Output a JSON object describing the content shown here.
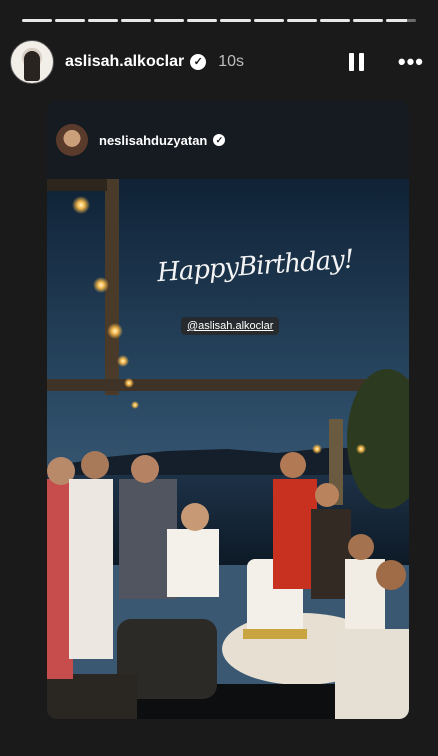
{
  "story": {
    "username": "aslisah.alkoclar",
    "time": "10s",
    "verified_glyph": "✓",
    "progress_segments": 12,
    "active_segment": 11
  },
  "shared_post": {
    "username": "neslisahduzyatan",
    "verified_glyph": "✓",
    "handwriting": "HappyBirthday!",
    "mention": "@aslisah.alkoclar"
  },
  "controls": {
    "pause_icon": "pause-icon",
    "more_label": "•••"
  }
}
